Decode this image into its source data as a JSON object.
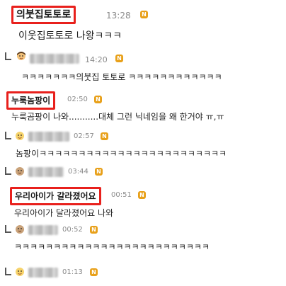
{
  "comments": [
    {
      "name": "의붓집토토로",
      "time": "13:28",
      "badge": "N",
      "text": "이웃집토토로 나왕ㅋㅋㅋ"
    },
    {
      "name": "",
      "time": "14:20",
      "badge": "N",
      "text": "ㅋㅋㅋㅋㅋㅋㅋ의붓집 토토로 ㅋㅋㅋㅋㅋㅋㅋㅋㅋㅋㅋㅋ"
    },
    {
      "name": "누룩놈팡이",
      "time": "02:50",
      "badge": "N",
      "text": "누룩곰팡이 나와...........대체 그런 닉네임을 왜 한거야 ㅠ,ㅠ"
    },
    {
      "name": "",
      "time": "02:57",
      "badge": "N",
      "text": "놈팡이ㅋㅋㅋㅋㅋㅋㅋㅋㅋㅋㅋㅋㅋㅋㅋㅋㅋㅋㅋㅋㅋㅋㅋㅋ"
    },
    {
      "name": "",
      "time": "03:44",
      "badge": "N",
      "text": ""
    },
    {
      "name": "우리아이가 갈라졌어요",
      "time": "00:51",
      "badge": "N",
      "text": "우리아이가 달라졌어요 나와"
    },
    {
      "name": "",
      "time": "00:52",
      "badge": "N",
      "text": "ㅋㅋㅋㅋㅋㅋㅋㅋㅋㅋㅋㅋㅋㅋㅋㅋㅋㅋㅋㅋㅋㅋㅋㅋㅋ"
    },
    {
      "name": "",
      "time": "01:13",
      "badge": "N",
      "text": ""
    }
  ],
  "colors": {
    "highlight": "#e8201c",
    "badge": "#e8a019",
    "time": "#8a8a8a"
  },
  "icons": {
    "reply": "reply-arrow-icon",
    "badge": "new-badge-icon",
    "avatar": "avatar-icon"
  }
}
